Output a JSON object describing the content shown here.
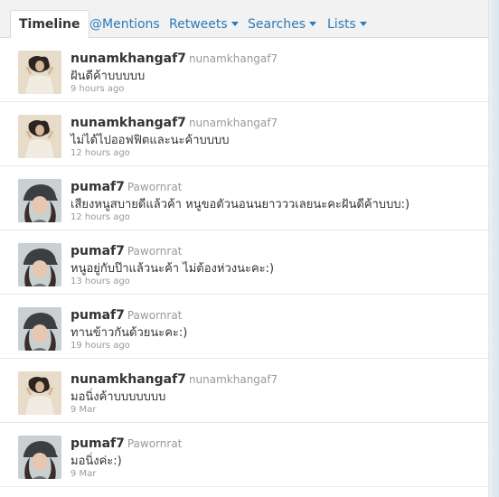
{
  "tabs": [
    {
      "label": "Timeline",
      "active": true,
      "dropdown": false
    },
    {
      "label": "@Mentions",
      "active": false,
      "dropdown": false
    },
    {
      "label": "Retweets",
      "active": false,
      "dropdown": true
    },
    {
      "label": "Searches",
      "active": false,
      "dropdown": true
    },
    {
      "label": "Lists",
      "active": false,
      "dropdown": true
    }
  ],
  "tweets": [
    {
      "screen_name": "nunamkhangaf7",
      "full_name": "nunamkhangaf7",
      "text": "ฝันดีค้าบบบบบ",
      "time": "9 hours ago",
      "avatar": "avatar-nunamkhangaf7"
    },
    {
      "screen_name": "nunamkhangaf7",
      "full_name": "nunamkhangaf7",
      "text": "ไม่ได้ไปออฟฟิตและนะค้าบบบบ",
      "time": "12 hours ago",
      "avatar": "avatar-nunamkhangaf7"
    },
    {
      "screen_name": "pumaf7",
      "full_name": "Pawornrat",
      "text": "เสียงหนูสบายดีแล้วค้า หนูขอตัวนอนนยาวววเลยนะคะฝันดีค้าบบบ:)",
      "time": "12 hours ago",
      "avatar": "avatar-pumaf7"
    },
    {
      "screen_name": "pumaf7",
      "full_name": "Pawornrat",
      "text": "หนูอยู่กับป๊าแล้วนะค้า ไม่ต้องห่วงนะคะ:)",
      "time": "13 hours ago",
      "avatar": "avatar-pumaf7"
    },
    {
      "screen_name": "pumaf7",
      "full_name": "Pawornrat",
      "text": "ทานข้าวกันด้วยนะคะ:)",
      "time": "19 hours ago",
      "avatar": "avatar-pumaf7"
    },
    {
      "screen_name": "nunamkhangaf7",
      "full_name": "nunamkhangaf7",
      "text": "มอนิ่งค้าบบบบบบบ",
      "time": "9 Mar",
      "avatar": "avatar-nunamkhangaf7"
    },
    {
      "screen_name": "pumaf7",
      "full_name": "Pawornrat",
      "text": "มอนิ่งค่ะ:)",
      "time": "9 Mar",
      "avatar": "avatar-pumaf7"
    }
  ]
}
